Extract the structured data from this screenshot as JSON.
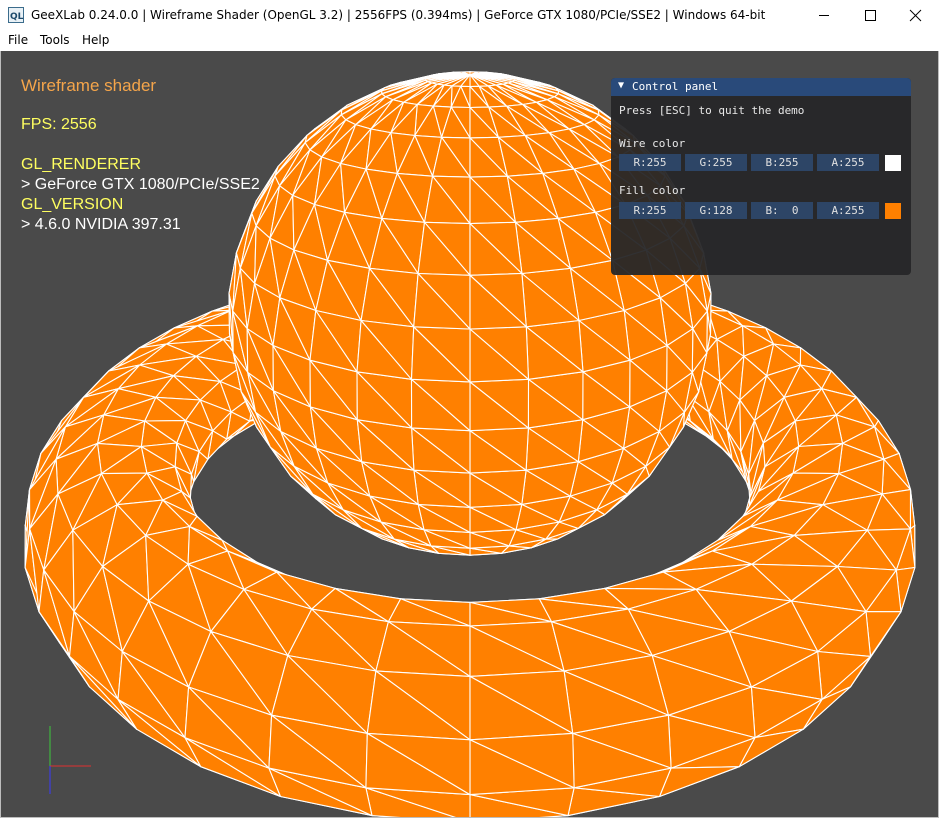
{
  "window": {
    "title": "GeeXLab 0.24.0.0 | Wireframe Shader (OpenGL 3.2) | 2556FPS (0.394ms) | GeForce GTX 1080/PCIe/SSE2 | Windows 64-bit",
    "icon": "geexlab-app-icon",
    "controls": [
      "minimize-icon",
      "maximize-icon",
      "close-icon"
    ]
  },
  "menu": {
    "file": "File",
    "tools": "Tools",
    "help": "Help"
  },
  "hud": {
    "demo_title": "Wireframe shader",
    "fps": "FPS: 2556",
    "renderer_label": "GL_RENDERER",
    "renderer_value": "> GeForce GTX 1080/PCIe/SSE2",
    "version_label": "GL_VERSION",
    "version_value": "> 4.6.0 NVIDIA 397.31"
  },
  "panel": {
    "title": "Control panel",
    "hint": "Press [ESC] to quit the demo",
    "wire_label": "Wire color",
    "wire": {
      "r": "R:255",
      "g": "G:255",
      "b": "B:255",
      "a": "A:255",
      "swatch": "#ffffff"
    },
    "fill_label": "Fill color",
    "fill": {
      "r": "R:255",
      "g": "G:128",
      "b": "B:  0",
      "a": "A:255",
      "swatch": "#ff8000"
    }
  },
  "colors": {
    "background": "#4a4a4a",
    "fill": "#ff8000",
    "wire": "#ffffff",
    "hud_title": "#f5a54a",
    "hud_yellow": "#ffff60",
    "hud_white": "#ffffff",
    "panel_header": "#294a7a",
    "field": "#2d4566"
  },
  "scene": {
    "objects": [
      "sphere-mesh",
      "torus-ring-mesh"
    ],
    "axes": [
      "x-axis",
      "y-axis",
      "z-axis"
    ]
  }
}
